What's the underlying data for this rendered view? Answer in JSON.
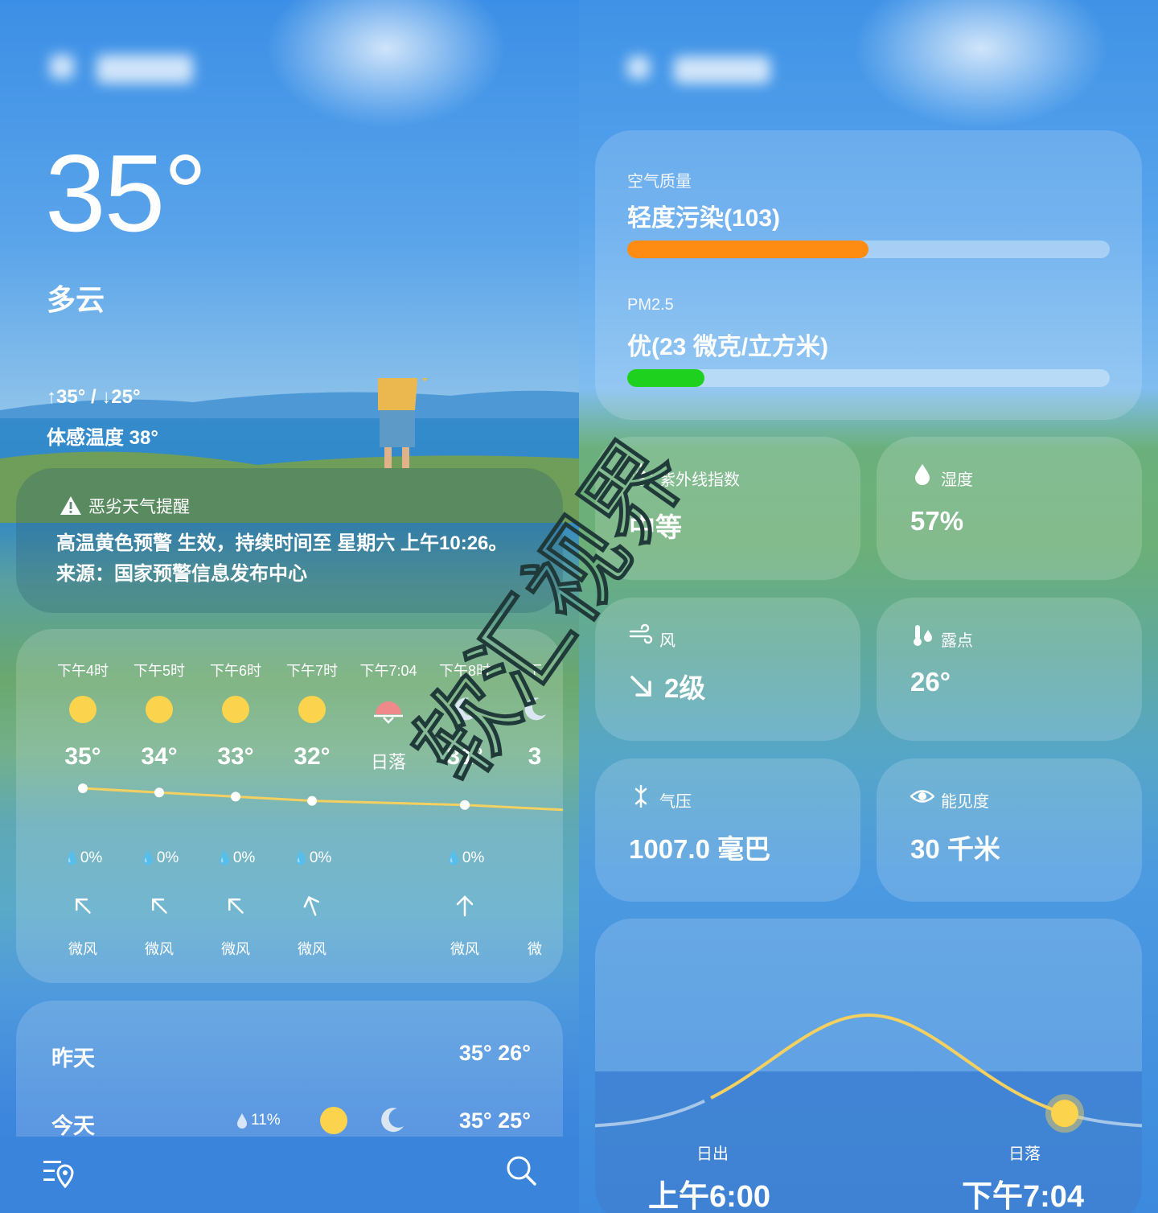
{
  "current": {
    "temperature": "35°",
    "condition": "多云",
    "high_low": "↑35° / ↓25°",
    "feels_like": "体感温度 38°"
  },
  "alert": {
    "title": "恶劣天气提醒",
    "line1": "高温黄色预警 生效，持续时间至 星期六 上午10:26。",
    "line2": "来源：国家预警信息发布中心"
  },
  "hourly": [
    {
      "time": "下午4时",
      "icon": "sun-icon",
      "temp": "35°",
      "rain": "0%",
      "wind_dir": "northwest",
      "wind": "微风"
    },
    {
      "time": "下午5时",
      "icon": "sun-icon",
      "temp": "34°",
      "rain": "0%",
      "wind_dir": "northwest",
      "wind": "微风"
    },
    {
      "time": "下午6时",
      "icon": "sun-icon",
      "temp": "33°",
      "rain": "0%",
      "wind_dir": "northwest",
      "wind": "微风"
    },
    {
      "time": "下午7时",
      "icon": "sun-icon",
      "temp": "32°",
      "rain": "0%",
      "wind_dir": "north-northwest",
      "wind": "微风"
    },
    {
      "time": "下午7:04",
      "icon": "sunset-icon",
      "temp": "日落",
      "rain": "",
      "wind_dir": "",
      "wind": ""
    },
    {
      "time": "下午8时",
      "icon": "moon-icon",
      "temp": "31°",
      "rain": "0%",
      "wind_dir": "north",
      "wind": "微风"
    },
    {
      "time": "下",
      "icon": "moon-icon",
      "temp": "3",
      "rain": "",
      "wind_dir": "",
      "wind": "微"
    }
  ],
  "daily": [
    {
      "day": "昨天",
      "range": "35° 26°"
    },
    {
      "day": "今天",
      "rain": "11%",
      "range": "35° 25°"
    }
  ],
  "air_quality": {
    "label": "空气质量",
    "value": "轻度污染(103)",
    "level": 0.5,
    "color": "#ff8c12"
  },
  "pm25": {
    "label": "PM2.5",
    "value": "优(23 微克/立方米)",
    "level": 0.16,
    "color": "#1fd11f"
  },
  "tiles": {
    "uv": {
      "label": "紫外线指数",
      "value": "中等"
    },
    "humidity": {
      "label": "湿度",
      "value": "57%"
    },
    "wind": {
      "label": "风",
      "value": "2级"
    },
    "dew": {
      "label": "露点",
      "value": "26°"
    },
    "pressure": {
      "label": "气压",
      "value": "1007.0 毫巴"
    },
    "visibility": {
      "label": "能见度",
      "value": "30 千米"
    }
  },
  "sun": {
    "sunrise_label": "日出",
    "sunrise": "上午6:00",
    "sunset_label": "日落",
    "sunset": "下午7:04",
    "progress": 0.82
  },
  "watermark": "软汇视界",
  "colors": {
    "sun": "#fcd34d",
    "accent_line": "#f3d060"
  }
}
